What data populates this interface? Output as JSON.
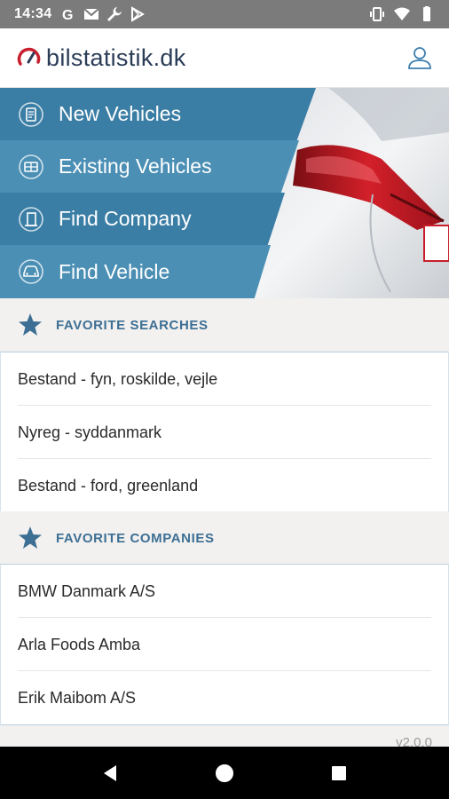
{
  "status_bar": {
    "time": "14:34",
    "icons_left": [
      "google-icon",
      "gmail-icon",
      "wrench-icon",
      "play-store-icon"
    ],
    "icons_right": [
      "vibrate-icon",
      "wifi-icon",
      "battery-icon"
    ]
  },
  "header": {
    "logo_text": "bilstatistik.dk",
    "user_icon": "user-icon"
  },
  "menu": {
    "items": [
      {
        "label": "New Vehicles",
        "icon": "document-icon",
        "color": "#3b7ea5"
      },
      {
        "label": "Existing Vehicles",
        "icon": "list-icon",
        "color": "#4b8fb5"
      },
      {
        "label": "Find Company",
        "icon": "building-icon",
        "color": "#3b7ea5"
      },
      {
        "label": "Find Vehicle",
        "icon": "car-icon",
        "color": "#4b8fb5"
      }
    ]
  },
  "favorite_searches": {
    "title": "FAVORITE SEARCHES",
    "items": [
      "Bestand - fyn, roskilde, vejle",
      "Nyreg - syddanmark",
      "Bestand - ford, greenland"
    ]
  },
  "favorite_companies": {
    "title": "FAVORITE COMPANIES",
    "items": [
      "BMW Danmark A/S",
      "Arla Foods Amba",
      "Erik Maibom A/S"
    ]
  },
  "version": "v2.0.0",
  "colors": {
    "brand_dark": "#2b3d57",
    "brand_red": "#c8202f",
    "accent_blue": "#3d6f94",
    "menu_blue": "#3b7ea5"
  }
}
